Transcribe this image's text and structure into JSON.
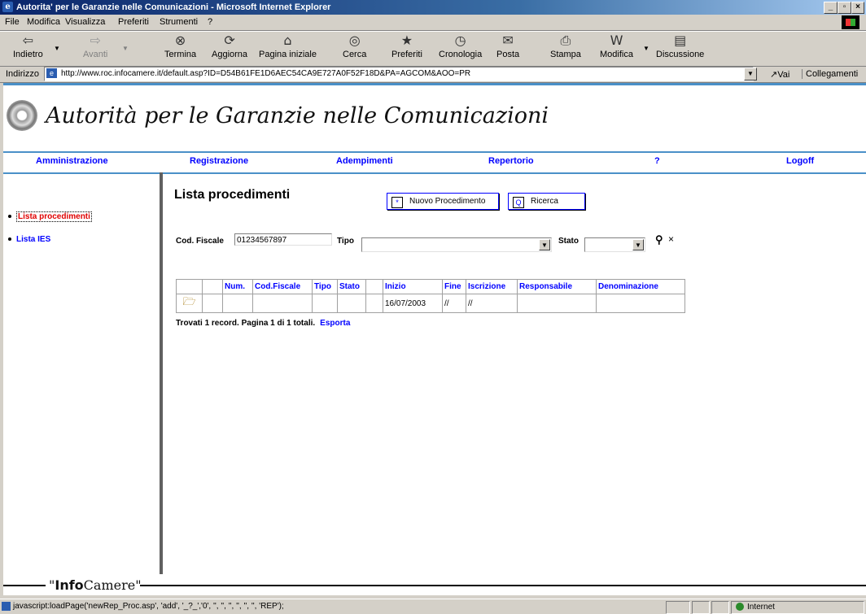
{
  "window": {
    "title": "Autorita' per le Garanzie nelle Comunicazioni - Microsoft Internet Explorer"
  },
  "menu": [
    "File",
    "Modifica",
    "Visualizza",
    "Preferiti",
    "Strumenti",
    "?"
  ],
  "toolbar": {
    "back": "Indietro",
    "forward": "Avanti",
    "stop": "Termina",
    "refresh": "Aggiorna",
    "home": "Pagina iniziale",
    "search": "Cerca",
    "favorites": "Preferiti",
    "history": "Cronologia",
    "mail": "Posta",
    "print": "Stampa",
    "edit": "Modifica",
    "discuss": "Discussione"
  },
  "address": {
    "label": "Indirizzo",
    "url": "http://www.roc.infocamere.it/default.asp?ID=D54B61FE1D6AEC54CA9E727A0F52F18D&PA=AGCOM&AOO=PR",
    "go": "Vai",
    "links": "Collegamenti"
  },
  "site": {
    "title": "Autorità per le Garanzie nelle Comunicazioni",
    "nav": [
      "Amministrazione",
      "Registrazione",
      "Adempimenti",
      "Repertorio",
      "?",
      "Logoff"
    ]
  },
  "sidebar": {
    "items": [
      "Lista procedimenti",
      "Lista IES"
    ]
  },
  "content": {
    "title": "Lista procedimenti",
    "new_button": "Nuovo Procedimento",
    "search_button": "Ricerca",
    "cf_label": "Cod. Fiscale",
    "cf_value": "01234567897",
    "tipo_label": "Tipo",
    "stato_label": "Stato",
    "columns": [
      "Num.",
      "Cod.Fiscale",
      "Tipo",
      "Stato",
      "Inizio",
      "Fine",
      "Iscrizione",
      "Responsabile",
      "Denominazione"
    ],
    "row": {
      "inizio": "16/07/2003",
      "fine": "//",
      "iscrizione": "//"
    },
    "found_text": "Trovati 1 record. Pagina 1 di 1 totali.",
    "export": "Esporta"
  },
  "footer": {
    "brand_q1": "\"",
    "brand_info": "Info",
    "brand_camere": "Camere",
    "brand_q2": "\""
  },
  "status": {
    "text": "javascript:loadPage('newRep_Proc.asp', 'add', '_?_','0', '', '', '', '', '', '', 'REP');",
    "zone": "Internet"
  }
}
